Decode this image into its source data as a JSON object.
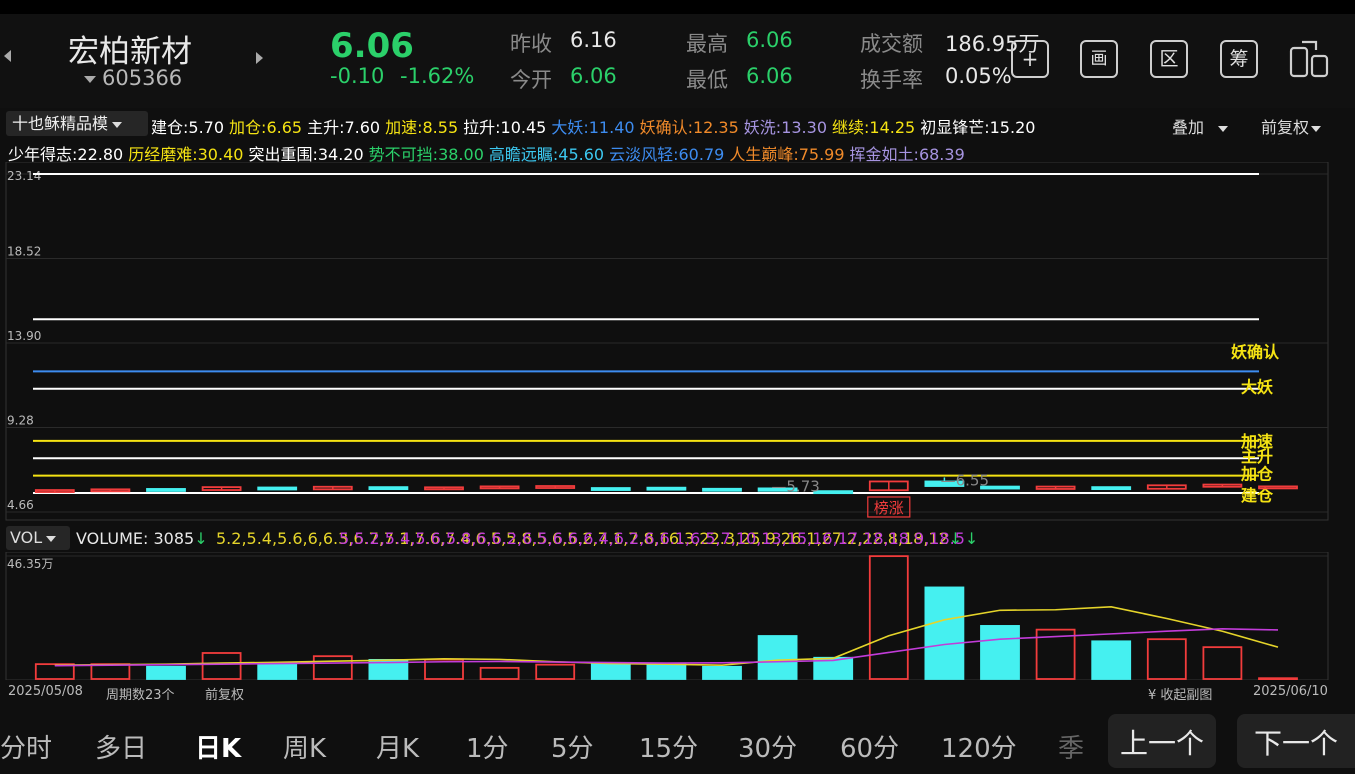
{
  "stock": {
    "name": "宏柏新材",
    "code": "605366",
    "price": "6.06",
    "change": "-0.10",
    "change_pct": "-1.62%"
  },
  "quote": {
    "prev_close_label": "昨收",
    "prev_close": "6.16",
    "open_label": "今开",
    "open": "6.06",
    "high_label": "最高",
    "high": "6.06",
    "low_label": "最低",
    "low": "6.06",
    "amount_label": "成交额",
    "amount": "186.95万",
    "turnover_label": "换手率",
    "turnover": "0.05%"
  },
  "toolbar_icons": [
    "plus-icon",
    "screen-icon",
    "zone-icon",
    "chip-icon",
    "switch-device-icon"
  ],
  "toolbar_glyphs": [
    "+",
    "画",
    "区",
    "筹",
    ""
  ],
  "indicator": {
    "selector": "十也稣精品模",
    "overlay": "叠加",
    "adjust": "前复权"
  },
  "levels_row1": [
    {
      "name": "建仓",
      "value": "5.70",
      "color": "#ffffff"
    },
    {
      "name": "加仓",
      "value": "6.65",
      "color": "#f5e313"
    },
    {
      "name": "主升",
      "value": "7.60",
      "color": "#ffffff"
    },
    {
      "name": "加速",
      "value": "8.55",
      "color": "#f5e313"
    },
    {
      "name": "拉升",
      "value": "10.45",
      "color": "#ffffff"
    },
    {
      "name": "大妖",
      "value": "11.40",
      "color": "#3d8cf0"
    },
    {
      "name": "妖确认",
      "value": "12.35",
      "color": "#f08a2a"
    },
    {
      "name": "妖洗",
      "value": "13.30",
      "color": "#a694e0"
    },
    {
      "name": "继续",
      "value": "14.25",
      "color": "#f5e313"
    },
    {
      "name": "初显锋芒",
      "value": "15.20",
      "color": "#ffffff"
    }
  ],
  "levels_row2": [
    {
      "name": "少年得志",
      "value": "22.80",
      "color": "#ffffff"
    },
    {
      "name": "历经磨难",
      "value": "30.40",
      "color": "#f5e313"
    },
    {
      "name": "突出重围",
      "value": "34.20",
      "color": "#ffffff"
    },
    {
      "name": "势不可挡",
      "value": "38.00",
      "color": "#2bd06a"
    },
    {
      "name": "高瞻远瞩",
      "value": "45.60",
      "color": "#3cc8f0"
    },
    {
      "name": "云淡风轻",
      "value": "60.79",
      "color": "#3d8cf0"
    },
    {
      "name": "人生巅峰",
      "value": "75.99",
      "color": "#f08a2a"
    },
    {
      "name": "挥金如土",
      "value": "68.39",
      "color": "#a694e0"
    }
  ],
  "chart_data": {
    "type": "candlestick",
    "y_ticks": [
      "23.14",
      "18.52",
      "13.90",
      "9.28",
      "4.66"
    ],
    "ylim": [
      4.66,
      23.14
    ],
    "level_lines": [
      {
        "value": 23.14,
        "color": "#ffffff",
        "label": ""
      },
      {
        "value": 15.2,
        "color": "#ffffff",
        "label": ""
      },
      {
        "value": 12.35,
        "color": "#3d8cf0",
        "label": "妖确认"
      },
      {
        "value": 11.4,
        "color": "#ffffff",
        "label": "大妖"
      },
      {
        "value": 8.55,
        "color": "#f5e313",
        "label": "加速"
      },
      {
        "value": 7.6,
        "color": "#ffffff",
        "label": "主升"
      },
      {
        "value": 6.65,
        "color": "#f5e313",
        "label": "加仓"
      },
      {
        "value": 5.7,
        "color": "#ffffff",
        "label": "建仓"
      }
    ],
    "candles": [
      {
        "o": 5.75,
        "c": 5.86,
        "h": 5.88,
        "l": 5.74
      },
      {
        "o": 5.8,
        "c": 5.9,
        "h": 5.91,
        "l": 5.78
      },
      {
        "o": 5.92,
        "c": 5.84,
        "h": 5.94,
        "l": 5.82
      },
      {
        "o": 5.86,
        "c": 6.02,
        "h": 6.04,
        "l": 5.85
      },
      {
        "o": 6.0,
        "c": 5.93,
        "h": 6.02,
        "l": 5.9
      },
      {
        "o": 5.9,
        "c": 6.04,
        "h": 6.05,
        "l": 5.88
      },
      {
        "o": 6.02,
        "c": 5.94,
        "h": 6.05,
        "l": 5.92
      },
      {
        "o": 5.92,
        "c": 6.01,
        "h": 6.02,
        "l": 5.9
      },
      {
        "o": 5.98,
        "c": 6.06,
        "h": 6.07,
        "l": 5.96
      },
      {
        "o": 5.99,
        "c": 6.08,
        "h": 6.08,
        "l": 5.97
      },
      {
        "o": 5.97,
        "c": 5.94,
        "h": 6.0,
        "l": 5.92
      },
      {
        "o": 5.99,
        "c": 5.94,
        "h": 6.01,
        "l": 5.93
      },
      {
        "o": 5.93,
        "c": 5.92,
        "h": 5.95,
        "l": 5.9
      },
      {
        "o": 5.95,
        "c": 5.82,
        "h": 5.97,
        "l": 5.78
      },
      {
        "o": 5.8,
        "c": 5.75,
        "h": 5.82,
        "l": 5.73
      },
      {
        "o": 5.85,
        "c": 6.33,
        "h": 6.33,
        "l": 5.85
      },
      {
        "o": 6.33,
        "c": 6.08,
        "h": 6.55,
        "l": 6.05
      },
      {
        "o": 6.05,
        "c": 5.97,
        "h": 6.08,
        "l": 5.95
      },
      {
        "o": 5.92,
        "c": 6.05,
        "h": 6.06,
        "l": 5.9
      },
      {
        "o": 6.02,
        "c": 5.94,
        "h": 6.05,
        "l": 5.92
      },
      {
        "o": 5.93,
        "c": 6.12,
        "h": 6.12,
        "l": 5.93
      },
      {
        "o": 6.04,
        "c": 6.16,
        "h": 6.18,
        "l": 6.02
      },
      {
        "o": 6.06,
        "c": 6.06,
        "h": 6.06,
        "l": 6.06
      }
    ],
    "annotations": {
      "low": "5.73",
      "high": "6.55",
      "badge": "榜涨"
    },
    "volume": {
      "label": "VOL",
      "current": "VOLUME: 3085",
      "ma5": [
        5.2,
        5.4,
        5.6,
        6.0,
        6.3,
        6.7,
        7.1,
        7.6,
        7.4,
        6.5,
        5.8,
        5.6,
        5.2,
        7.1,
        7.8,
        16.3,
        22.3,
        25.9,
        26.1,
        27.2,
        22.8,
        18.0,
        12.0
      ],
      "ma10": [
        5.0,
        5.2,
        5.4,
        5.6,
        5.8,
        6.0,
        6.2,
        6.5,
        6.6,
        6.4,
        6.2,
        6.0,
        6.1,
        6.5,
        7.0,
        10.0,
        13.0,
        15.0,
        16.0,
        17.0,
        18.0,
        18.9,
        18.5
      ],
      "max_label": "46.35万",
      "ymax": 46.35,
      "values": [
        5.6,
        5.6,
        4.6,
        9.8,
        6.0,
        8.6,
        7.2,
        7.3,
        4.2,
        5.4,
        5.6,
        5.6,
        4.6,
        16.2,
        8.0,
        46.3,
        34.5,
        20.0,
        18.6,
        14.2,
        15.0,
        12.0,
        0.3
      ]
    },
    "x_start": "2025/05/08",
    "x_end": "2025/06/10",
    "period_count": "周期数23个",
    "adjust": "前复权",
    "collapse": "收起副图"
  },
  "period_tabs": [
    "分时",
    "多日",
    "日K",
    "周K",
    "月K",
    "1分",
    "5分",
    "15分",
    "30分",
    "60分",
    "120分",
    "季"
  ],
  "active_tab": "日K",
  "nav": {
    "prev": "上一个",
    "next": "下一个"
  }
}
